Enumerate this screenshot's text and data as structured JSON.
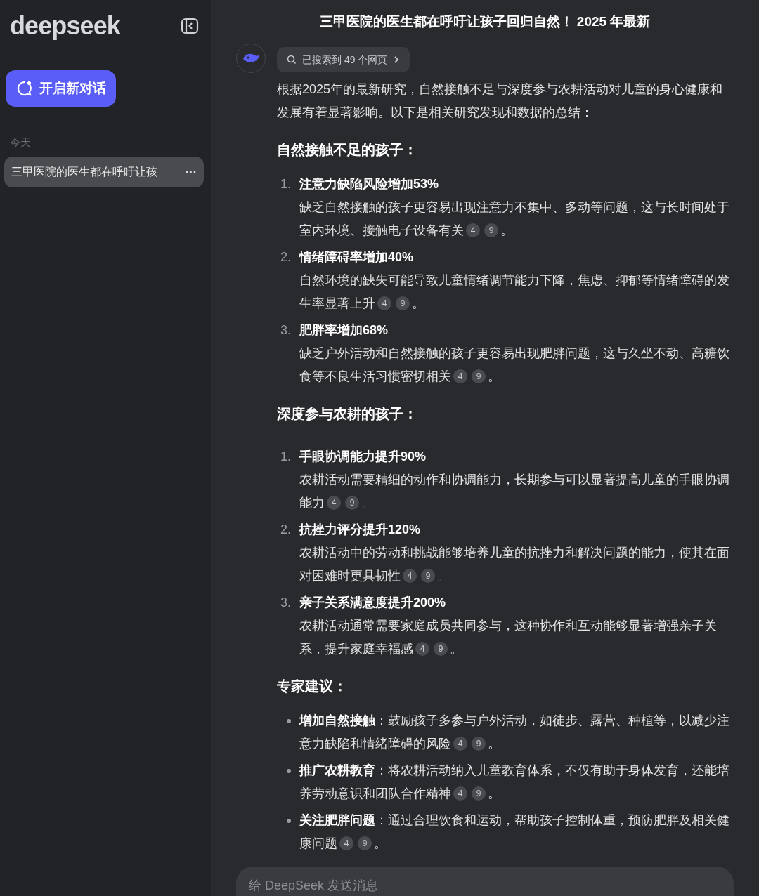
{
  "sidebar": {
    "logo": "deepseek",
    "new_chat": "开启新对话",
    "section_label": "今天",
    "history": [
      {
        "title": "三甲医院的医生都在呼吁让孩",
        "selected": true,
        "menu": "···"
      }
    ]
  },
  "chat": {
    "title": "三甲医院的医生都在呼吁让孩子回归自然！ 2025 年最新",
    "search_chip": "已搜索到 49 个网页",
    "intro": "根据2025年的最新研究，自然接触不足与深度参与农耕活动对儿童的身心健康和发展有着显著影响。以下是相关研究发现和数据的总结：",
    "sections": [
      {
        "heading": "自然接触不足的孩子：",
        "kind": "numbered",
        "items": [
          {
            "marker": "1.",
            "title": "注意力缺陷风险增加53%",
            "text": "缺乏自然接触的孩子更容易出现注意力不集中、多动等问题，这与长时间处于室内环境、接触电子设备有关",
            "citations": [
              "4",
              "9"
            ],
            "tail": "。"
          },
          {
            "marker": "2.",
            "title": "情绪障碍率增加40%",
            "text": "自然环境的缺失可能导致儿童情绪调节能力下降，焦虑、抑郁等情绪障碍的发生率显著上升",
            "citations": [
              "4",
              "9"
            ],
            "tail": "。"
          },
          {
            "marker": "3.",
            "title": "肥胖率增加68%",
            "text": "缺乏户外活动和自然接触的孩子更容易出现肥胖问题，这与久坐不动、高糖饮食等不良生活习惯密切相关",
            "citations": [
              "4",
              "9"
            ],
            "tail": "。"
          }
        ]
      },
      {
        "heading": "深度参与农耕的孩子：",
        "kind": "numbered",
        "items": [
          {
            "marker": "1.",
            "title": "手眼协调能力提升90%",
            "text": "农耕活动需要精细的动作和协调能力，长期参与可以显著提高儿童的手眼协调能力",
            "citations": [
              "4",
              "9"
            ],
            "tail": "。"
          },
          {
            "marker": "2.",
            "title": "抗挫力评分提升120%",
            "text": "农耕活动中的劳动和挑战能够培养儿童的抗挫力和解决问题的能力，使其在面对困难时更具韧性",
            "citations": [
              "4",
              "9"
            ],
            "tail": "。"
          },
          {
            "marker": "3.",
            "title": "亲子关系满意度提升200%",
            "text": "农耕活动通常需要家庭成员共同参与，这种协作和互动能够显著增强亲子关系，提升家庭幸福感",
            "citations": [
              "4",
              "9"
            ],
            "tail": "。"
          }
        ]
      },
      {
        "heading": "专家建议：",
        "kind": "bullet",
        "items": [
          {
            "title": "增加自然接触",
            "text": "：鼓励孩子多参与户外活动，如徒步、露营、种植等，以减少注意力缺陷和情绪障碍的风险",
            "citations": [
              "4",
              "9"
            ],
            "tail": "。"
          },
          {
            "title": "推广农耕教育",
            "text": "：将农耕活动纳入儿童教育体系，不仅有助于身体发育，还能培养劳动意识和团队合作精神",
            "citations": [
              "4",
              "9"
            ],
            "tail": "。"
          },
          {
            "title": "关注肥胖问题",
            "text": "：通过合理饮食和运动，帮助孩子控制体重，预防肥胖及相关健康问题",
            "citations": [
              "4",
              "9"
            ],
            "tail": "。"
          }
        ]
      }
    ]
  },
  "input": {
    "placeholder": "给 DeepSeek 发送消息"
  }
}
